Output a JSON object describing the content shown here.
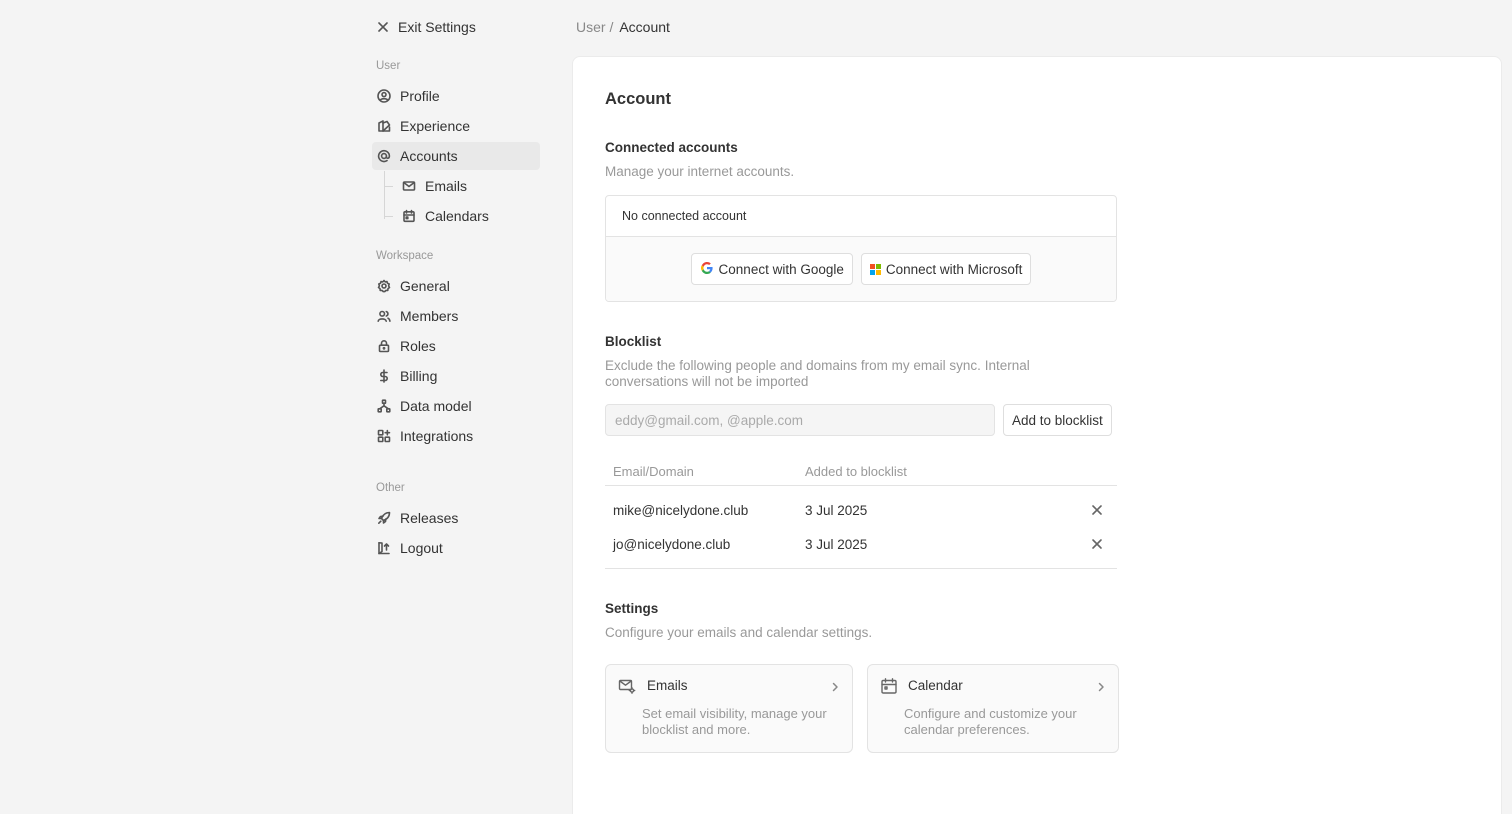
{
  "sidebar": {
    "exit_label": "Exit Settings",
    "sections": {
      "user": "User",
      "workspace": "Workspace",
      "other": "Other"
    },
    "items": {
      "profile": "Profile",
      "experience": "Experience",
      "accounts": "Accounts",
      "emails": "Emails",
      "calendars": "Calendars",
      "general": "General",
      "members": "Members",
      "roles": "Roles",
      "billing": "Billing",
      "data_model": "Data model",
      "integrations": "Integrations",
      "releases": "Releases",
      "logout": "Logout"
    },
    "active_item": "accounts"
  },
  "breadcrumb": {
    "parent": "User /",
    "current": "Account"
  },
  "main": {
    "title": "Account",
    "connected": {
      "heading": "Connected accounts",
      "description": "Manage your internet accounts.",
      "empty_text": "No connected account",
      "google_button": "Connect with Google",
      "microsoft_button": "Connect with Microsoft"
    },
    "blocklist": {
      "heading": "Blocklist",
      "description": "Exclude the following people and domains from my email sync. Internal conversations will not be imported",
      "input_placeholder": "eddy@gmail.com, @apple.com",
      "input_value": "",
      "add_button": "Add to blocklist",
      "columns": [
        "Email/Domain",
        "Added to blocklist"
      ],
      "rows": [
        {
          "email": "mike@nicelydone.club",
          "added": "3 Jul 2025"
        },
        {
          "email": "jo@nicelydone.club",
          "added": "3 Jul 2025"
        }
      ]
    },
    "settings": {
      "heading": "Settings",
      "description": "Configure your emails and calendar settings.",
      "cards": [
        {
          "title": "Emails",
          "description": "Set email visibility, manage your blocklist and more.",
          "icon": "mail-settings-icon"
        },
        {
          "title": "Calendar",
          "description": "Configure and customize your calendar preferences.",
          "icon": "calendar-icon"
        }
      ]
    }
  },
  "colors": {
    "background": "#f4f4f4",
    "panel": "#ffffff",
    "active_nav": "#e9e9e9",
    "muted_text": "#999999",
    "google_blue": "#4285F4",
    "ms_red": "#F25022",
    "ms_green": "#7FBA00",
    "ms_blue": "#00A4EF",
    "ms_yellow": "#FFB900"
  }
}
